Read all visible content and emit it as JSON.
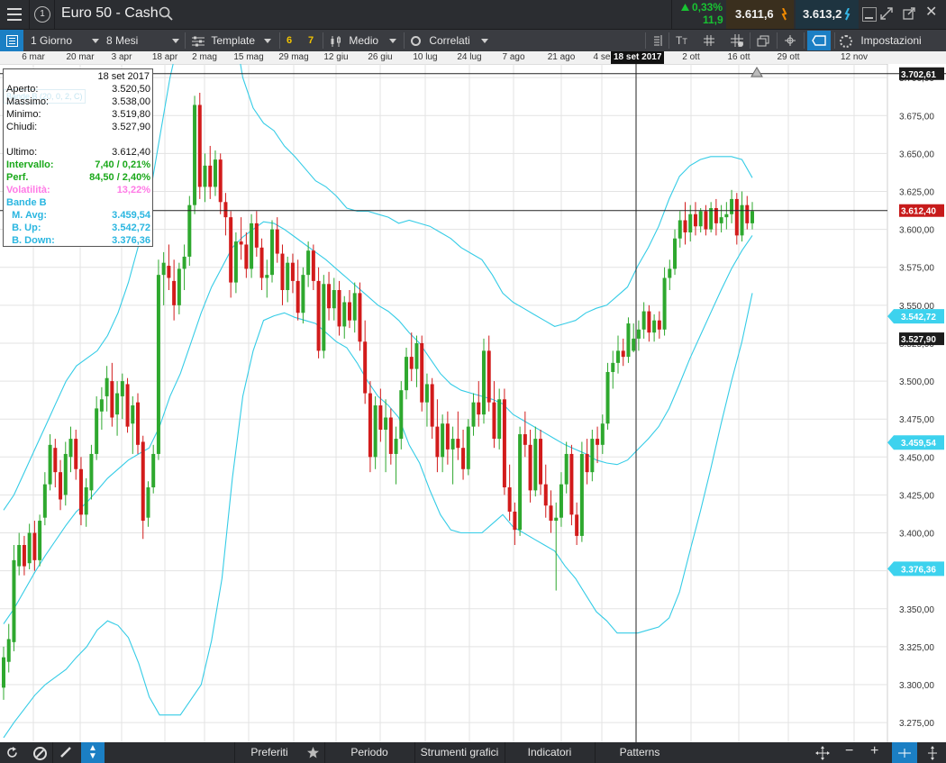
{
  "header": {
    "menu_icon": "hamburger-icon",
    "info_icon": "info-icon",
    "title": "Euro 50 - Cash",
    "search_icon": "search-icon",
    "change_pct": "0,33%",
    "change_abs": "11,9",
    "sell_price": "3.611,6",
    "buy_price": "3.613,2",
    "colors": {
      "up": "#18c332",
      "sell_bg": "#3a2f1e",
      "buy_bg": "#1e3440",
      "sell_arrow": "#f08a00",
      "buy_arrow": "#35b6e6"
    }
  },
  "toolbar": {
    "interval": "1 Giorno",
    "range": "8 Mesi",
    "template": "Template",
    "template_badges": [
      "6",
      "7"
    ],
    "chart_type": "Medio",
    "related": "Correlati",
    "settings": "Impostazioni"
  },
  "datebar": {
    "labels": [
      "6 mar",
      "20 mar",
      "3 apr",
      "18 apr",
      "2 mag",
      "15 mag",
      "29 mag",
      "12 giu",
      "26 giu",
      "10 lug",
      "24 lug",
      "7 ago",
      "21 ago",
      "4 se",
      "2 ott",
      "16 ott",
      "29 ott",
      "12 nov"
    ],
    "crosshair_date": "18 set 2017"
  },
  "infobox": {
    "date": "18 set 2017",
    "ghost_label": "Bande B (20, 0, 2, C)",
    "rows": [
      {
        "label": "Aperto:",
        "value": "3.520,50",
        "color": "#111111"
      },
      {
        "label": "Massimo:",
        "value": "3.538,00",
        "color": "#111111"
      },
      {
        "label": "Minimo:",
        "value": "3.519,80",
        "color": "#111111"
      },
      {
        "label": "Chiudi:",
        "value": "3.527,90",
        "color": "#111111"
      },
      {
        "label": "",
        "value": "",
        "color": "#111111"
      },
      {
        "label": "Ultimo:",
        "value": "3.612,40",
        "color": "#111111"
      },
      {
        "label": "Intervallo:",
        "value": "7,40 / 0,21%",
        "color": "#1aa81a"
      },
      {
        "label": "Perf.",
        "value": "84,50 / 2,40%",
        "color": "#1aa81a"
      },
      {
        "label": "Volatilità:",
        "value": "13,22%",
        "color": "#ff7ae6"
      },
      {
        "label": "Bande B",
        "value": "",
        "color": "#2ab6e0"
      },
      {
        "label": "  M. Avg:",
        "value": "3.459,54",
        "color": "#2ab6e0"
      },
      {
        "label": "  B. Up:",
        "value": "3.542,72",
        "color": "#2ab6e0"
      },
      {
        "label": "  B. Down:",
        "value": "3.376,36",
        "color": "#2ab6e0"
      }
    ]
  },
  "bottombar": {
    "tabs": [
      "Preferiti",
      "Periodo",
      "Strumenti grafici",
      "Indicatori",
      "Patterns"
    ]
  },
  "chart_data": {
    "type": "candlestick",
    "y_axis": {
      "min": 3262,
      "max": 3709,
      "ticks": [
        3275,
        3300,
        3325,
        3350,
        3375,
        3400,
        3425,
        3450,
        3475,
        3500,
        3525,
        3550,
        3575,
        3600,
        3625,
        3650,
        3675,
        3700
      ],
      "tick_labels": [
        "3.275,00",
        "3.300,00",
        "3.325,00",
        "3.350,00",
        "3.375,00",
        "3.400,00",
        "3.425,00",
        "3.450,00",
        "3.475,00",
        "3.500,00",
        "3.525,00",
        "3.550,00",
        "3.575,00",
        "3.600,00",
        "3.625,00",
        "3.650,00",
        "3.675,00",
        "3.700,00"
      ]
    },
    "grid": true,
    "price_tags": [
      {
        "label": "3.702,61",
        "value": 3702.61,
        "style": "dark"
      },
      {
        "label": "3.612,40",
        "value": 3612.4,
        "style": "red"
      },
      {
        "label": "3.542,72",
        "value": 3542.72,
        "style": "cyan"
      },
      {
        "label": "3.527,90",
        "value": 3527.9,
        "style": "dark"
      },
      {
        "label": "3.459,54",
        "value": 3459.54,
        "style": "cyan"
      },
      {
        "label": "3.376,36",
        "value": 3376.36,
        "style": "cyan"
      }
    ],
    "crosshair": {
      "price": 3612.4,
      "date": "18 set 2017"
    },
    "high_line": 3702.61,
    "colors": {
      "up": "#2ea82e",
      "down": "#d21b1b",
      "band": "#35cce6",
      "grid": "#e3e3e3"
    },
    "candles": [
      [
        3298,
        3325,
        3290,
        3318
      ],
      [
        3315,
        3340,
        3308,
        3330
      ],
      [
        3328,
        3392,
        3322,
        3382
      ],
      [
        3378,
        3400,
        3372,
        3392
      ],
      [
        3392,
        3398,
        3372,
        3378
      ],
      [
        3380,
        3406,
        3376,
        3400
      ],
      [
        3400,
        3408,
        3375,
        3382
      ],
      [
        3382,
        3412,
        3378,
        3408
      ],
      [
        3410,
        3440,
        3405,
        3432
      ],
      [
        3432,
        3465,
        3428,
        3458
      ],
      [
        3456,
        3462,
        3430,
        3440
      ],
      [
        3440,
        3448,
        3415,
        3422
      ],
      [
        3425,
        3460,
        3418,
        3452
      ],
      [
        3450,
        3470,
        3440,
        3462
      ],
      [
        3462,
        3468,
        3435,
        3442
      ],
      [
        3442,
        3450,
        3405,
        3412
      ],
      [
        3412,
        3436,
        3404,
        3430
      ],
      [
        3428,
        3458,
        3422,
        3452
      ],
      [
        3452,
        3490,
        3448,
        3482
      ],
      [
        3480,
        3496,
        3468,
        3488
      ],
      [
        3490,
        3510,
        3480,
        3502
      ],
      [
        3500,
        3512,
        3470,
        3476
      ],
      [
        3478,
        3500,
        3464,
        3492
      ],
      [
        3490,
        3505,
        3475,
        3500
      ],
      [
        3498,
        3502,
        3466,
        3470
      ],
      [
        3472,
        3490,
        3452,
        3484
      ],
      [
        3486,
        3492,
        3452,
        3458
      ],
      [
        3460,
        3464,
        3396,
        3408
      ],
      [
        3410,
        3434,
        3404,
        3430
      ],
      [
        3430,
        3458,
        3426,
        3452
      ],
      [
        3452,
        3580,
        3448,
        3570
      ],
      [
        3570,
        3585,
        3550,
        3578
      ],
      [
        3576,
        3590,
        3560,
        3568
      ],
      [
        3566,
        3580,
        3540,
        3550
      ],
      [
        3550,
        3578,
        3544,
        3574
      ],
      [
        3574,
        3590,
        3560,
        3582
      ],
      [
        3582,
        3622,
        3576,
        3616
      ],
      [
        3616,
        3688,
        3610,
        3682
      ],
      [
        3682,
        3690,
        3620,
        3628
      ],
      [
        3628,
        3650,
        3618,
        3642
      ],
      [
        3642,
        3655,
        3620,
        3628
      ],
      [
        3628,
        3652,
        3622,
        3646
      ],
      [
        3646,
        3650,
        3610,
        3618
      ],
      [
        3618,
        3624,
        3596,
        3608
      ],
      [
        3608,
        3612,
        3555,
        3565
      ],
      [
        3565,
        3598,
        3558,
        3592
      ],
      [
        3592,
        3608,
        3580,
        3590
      ],
      [
        3590,
        3598,
        3568,
        3574
      ],
      [
        3574,
        3610,
        3568,
        3604
      ],
      [
        3604,
        3612,
        3582,
        3588
      ],
      [
        3588,
        3594,
        3560,
        3568
      ],
      [
        3568,
        3580,
        3555,
        3570
      ],
      [
        3570,
        3606,
        3565,
        3600
      ],
      [
        3600,
        3608,
        3578,
        3584
      ],
      [
        3584,
        3590,
        3550,
        3560
      ],
      [
        3560,
        3582,
        3552,
        3578
      ],
      [
        3578,
        3584,
        3558,
        3566
      ],
      [
        3566,
        3580,
        3540,
        3545
      ],
      [
        3545,
        3575,
        3538,
        3570
      ],
      [
        3570,
        3592,
        3562,
        3586
      ],
      [
        3586,
        3590,
        3560,
        3566
      ],
      [
        3566,
        3575,
        3515,
        3520
      ],
      [
        3520,
        3570,
        3515,
        3564
      ],
      [
        3564,
        3572,
        3540,
        3548
      ],
      [
        3548,
        3568,
        3540,
        3560
      ],
      [
        3560,
        3566,
        3530,
        3536
      ],
      [
        3536,
        3556,
        3528,
        3552
      ],
      [
        3552,
        3560,
        3535,
        3540
      ],
      [
        3540,
        3565,
        3532,
        3558
      ],
      [
        3558,
        3565,
        3520,
        3526
      ],
      [
        3526,
        3540,
        3485,
        3492
      ],
      [
        3492,
        3500,
        3440,
        3450
      ],
      [
        3450,
        3490,
        3442,
        3484
      ],
      [
        3484,
        3495,
        3460,
        3468
      ],
      [
        3468,
        3488,
        3440,
        3476
      ],
      [
        3476,
        3482,
        3445,
        3452
      ],
      [
        3452,
        3470,
        3432,
        3462
      ],
      [
        3462,
        3500,
        3455,
        3494
      ],
      [
        3494,
        3522,
        3488,
        3516
      ],
      [
        3516,
        3532,
        3500,
        3508
      ],
      [
        3508,
        3530,
        3496,
        3525
      ],
      [
        3525,
        3530,
        3480,
        3486
      ],
      [
        3486,
        3505,
        3470,
        3498
      ],
      [
        3498,
        3502,
        3462,
        3470
      ],
      [
        3470,
        3488,
        3440,
        3450
      ],
      [
        3450,
        3478,
        3440,
        3472
      ],
      [
        3472,
        3480,
        3445,
        3455
      ],
      [
        3455,
        3470,
        3432,
        3462
      ],
      [
        3462,
        3480,
        3448,
        3456
      ],
      [
        3456,
        3468,
        3435,
        3442
      ],
      [
        3442,
        3475,
        3438,
        3470
      ],
      [
        3470,
        3492,
        3464,
        3486
      ],
      [
        3486,
        3500,
        3470,
        3478
      ],
      [
        3478,
        3528,
        3472,
        3520
      ],
      [
        3520,
        3530,
        3480,
        3486
      ],
      [
        3486,
        3500,
        3456,
        3462
      ],
      [
        3462,
        3495,
        3455,
        3488
      ],
      [
        3488,
        3495,
        3425,
        3430
      ],
      [
        3430,
        3445,
        3408,
        3414
      ],
      [
        3414,
        3420,
        3392,
        3402
      ],
      [
        3402,
        3470,
        3398,
        3465
      ],
      [
        3465,
        3480,
        3450,
        3458
      ],
      [
        3458,
        3468,
        3420,
        3428
      ],
      [
        3428,
        3470,
        3424,
        3462
      ],
      [
        3462,
        3468,
        3425,
        3432
      ],
      [
        3432,
        3445,
        3410,
        3418
      ],
      [
        3418,
        3428,
        3400,
        3408
      ],
      [
        3408,
        3420,
        3362,
        3410
      ],
      [
        3410,
        3440,
        3404,
        3432
      ],
      [
        3432,
        3460,
        3426,
        3452
      ],
      [
        3452,
        3458,
        3405,
        3412
      ],
      [
        3412,
        3420,
        3392,
        3398
      ],
      [
        3398,
        3460,
        3394,
        3452
      ],
      [
        3452,
        3462,
        3432,
        3440
      ],
      [
        3440,
        3468,
        3434,
        3462
      ],
      [
        3462,
        3470,
        3446,
        3458
      ],
      [
        3458,
        3478,
        3452,
        3472
      ],
      [
        3472,
        3512,
        3468,
        3506
      ],
      [
        3506,
        3520,
        3495,
        3512
      ],
      [
        3512,
        3530,
        3505,
        3520
      ],
      [
        3520,
        3528,
        3510,
        3516
      ],
      [
        3516,
        3542,
        3512,
        3538
      ],
      [
        3520,
        3538,
        3519,
        3528
      ],
      [
        3528,
        3540,
        3520,
        3534
      ],
      [
        3534,
        3552,
        3528,
        3546
      ],
      [
        3546,
        3550,
        3526,
        3532
      ],
      [
        3532,
        3544,
        3526,
        3540
      ],
      [
        3540,
        3546,
        3528,
        3534
      ],
      [
        3534,
        3575,
        3530,
        3568
      ],
      [
        3568,
        3580,
        3560,
        3574
      ],
      [
        3574,
        3600,
        3570,
        3594
      ],
      [
        3594,
        3612,
        3588,
        3606
      ],
      [
        3606,
        3618,
        3590,
        3598
      ],
      [
        3598,
        3616,
        3592,
        3610
      ],
      [
        3610,
        3618,
        3596,
        3602
      ],
      [
        3602,
        3614,
        3598,
        3612
      ],
      [
        3612,
        3616,
        3596,
        3600
      ],
      [
        3600,
        3618,
        3598,
        3614
      ],
      [
        3614,
        3620,
        3596,
        3604
      ],
      [
        3604,
        3616,
        3598,
        3608
      ],
      [
        3608,
        3618,
        3600,
        3610
      ],
      [
        3610,
        3626,
        3604,
        3620
      ],
      [
        3620,
        3624,
        3590,
        3596
      ],
      [
        3596,
        3625,
        3592,
        3616
      ],
      [
        3616,
        3622,
        3600,
        3604
      ],
      [
        3604,
        3618,
        3600,
        3612
      ]
    ],
    "bollinger": {
      "upper": [
        3415,
        3425,
        3440,
        3455,
        3470,
        3485,
        3500,
        3510,
        3515,
        3520,
        3530,
        3545,
        3565,
        3590,
        3620,
        3660,
        3700,
        3730,
        3760,
        3790,
        3795,
        3780,
        3740,
        3700,
        3680,
        3670,
        3665,
        3655,
        3648,
        3640,
        3632,
        3628,
        3622,
        3614,
        3612,
        3612,
        3610,
        3608,
        3604,
        3606,
        3604,
        3602,
        3598,
        3594,
        3588,
        3584,
        3580,
        3570,
        3558,
        3552,
        3548,
        3544,
        3540,
        3536,
        3538,
        3540,
        3545,
        3548,
        3550,
        3556,
        3562,
        3576,
        3588,
        3602,
        3620,
        3635,
        3642,
        3646,
        3648,
        3648,
        3648,
        3646,
        3634
      ],
      "middle": [
        3340,
        3350,
        3362,
        3374,
        3385,
        3395,
        3405,
        3414,
        3420,
        3428,
        3436,
        3442,
        3448,
        3452,
        3456,
        3470,
        3490,
        3505,
        3525,
        3545,
        3562,
        3575,
        3588,
        3595,
        3600,
        3605,
        3604,
        3600,
        3595,
        3590,
        3585,
        3580,
        3574,
        3568,
        3562,
        3556,
        3550,
        3546,
        3540,
        3532,
        3525,
        3515,
        3505,
        3498,
        3494,
        3492,
        3490,
        3488,
        3485,
        3478,
        3474,
        3470,
        3466,
        3462,
        3458,
        3455,
        3452,
        3448,
        3446,
        3445,
        3448,
        3455,
        3462,
        3470,
        3482,
        3498,
        3515,
        3530,
        3545,
        3560,
        3574,
        3586,
        3596
      ],
      "lower": [
        3265,
        3275,
        3284,
        3293,
        3300,
        3305,
        3310,
        3318,
        3325,
        3336,
        3342,
        3339,
        3331,
        3314,
        3292,
        3280,
        3280,
        3280,
        3290,
        3300,
        3329,
        3370,
        3436,
        3490,
        3520,
        3540,
        3543,
        3545,
        3542,
        3540,
        3538,
        3532,
        3526,
        3522,
        3512,
        3500,
        3490,
        3484,
        3476,
        3458,
        3446,
        3428,
        3412,
        3402,
        3400,
        3400,
        3400,
        3406,
        3412,
        3404,
        3400,
        3396,
        3392,
        3388,
        3378,
        3370,
        3359,
        3348,
        3342,
        3334,
        3334,
        3334,
        3336,
        3338,
        3344,
        3361,
        3388,
        3414,
        3442,
        3472,
        3500,
        3526,
        3558
      ]
    }
  }
}
